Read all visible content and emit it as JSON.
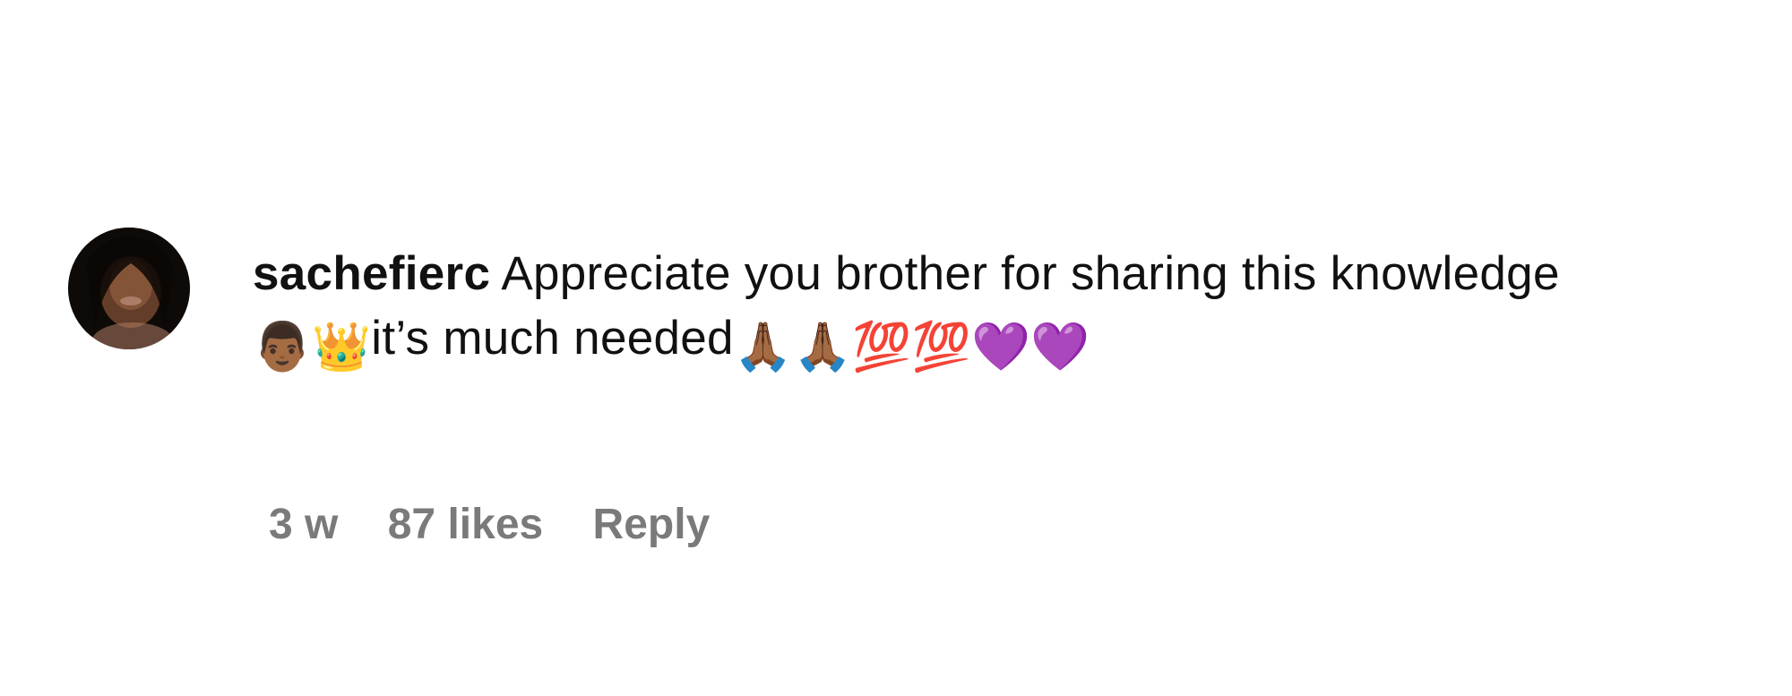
{
  "comment": {
    "avatar_icon": "profile-photo",
    "username": "sachefierc",
    "text_part1": "Appreciate you brother for sharing this knowledge ",
    "emoji_crown_person": "👨🏾‍👑",
    "text_part2": "it’s much needed",
    "emoji_sequence": [
      "🙏🏾",
      "🙏🏾",
      "💯",
      "💯",
      "💜",
      "💜"
    ]
  },
  "meta": {
    "time": "3 w",
    "likes": "87 likes",
    "reply_label": "Reply"
  }
}
